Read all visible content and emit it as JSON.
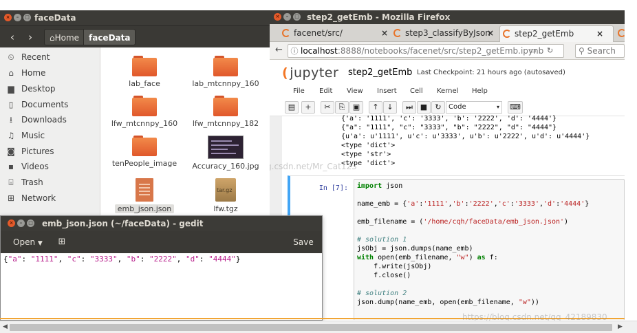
{
  "nautilus": {
    "title": "faceData",
    "nav": {
      "back": "‹",
      "forward": "›"
    },
    "breadcrumb": {
      "home": "Home",
      "current": "faceData"
    },
    "sidebar": [
      {
        "icon": "clock-icon",
        "glyph": "⏲",
        "label": "Recent"
      },
      {
        "icon": "home-icon",
        "glyph": "⌂",
        "label": "Home"
      },
      {
        "icon": "desktop-icon",
        "glyph": "▆",
        "label": "Desktop"
      },
      {
        "icon": "documents-icon",
        "glyph": "▯",
        "label": "Documents"
      },
      {
        "icon": "downloads-icon",
        "glyph": "⭳",
        "label": "Downloads"
      },
      {
        "icon": "music-icon",
        "glyph": "♫",
        "label": "Music"
      },
      {
        "icon": "pictures-icon",
        "glyph": "◙",
        "label": "Pictures"
      },
      {
        "icon": "videos-icon",
        "glyph": "▪",
        "label": "Videos"
      },
      {
        "icon": "trash-icon",
        "glyph": "⌻",
        "label": "Trash"
      },
      {
        "icon": "network-icon",
        "glyph": "⊞",
        "label": "Network"
      }
    ],
    "files": [
      {
        "name": "lab_face",
        "kind": "folder"
      },
      {
        "name": "lab_mtcnnpy_160",
        "kind": "folder"
      },
      {
        "name": "lfw_mtcnnpy_160",
        "kind": "folder"
      },
      {
        "name": "lfw_mtcnnpy_182",
        "kind": "folder"
      },
      {
        "name": "tenPeople_image",
        "kind": "folder"
      },
      {
        "name": "Accuracy_160.jpg",
        "kind": "image"
      },
      {
        "name": "emb_json.json",
        "kind": "document",
        "selected": true
      },
      {
        "name": "lfw.tgz",
        "kind": "archive",
        "badge": "tar.gz"
      }
    ]
  },
  "firefox": {
    "title": "step2_getEmb - Mozilla Firefox",
    "tabs": [
      {
        "label": "facenet/src/",
        "close": "×"
      },
      {
        "label": "step3_classifyByJson",
        "close": "×"
      },
      {
        "label": "step2_getEmb",
        "close": "×",
        "active": true
      }
    ],
    "url": {
      "host": "localhost",
      "rest": ":8888/notebooks/facenet/src/step2_getEmb.ipynb"
    },
    "search_placeholder": "Search"
  },
  "jupyter": {
    "logo": "jupyter",
    "notebook_name": "step2_getEmb",
    "checkpoint": "Last Checkpoint: 21 hours ago (autosaved)",
    "menu": [
      "File",
      "Edit",
      "View",
      "Insert",
      "Cell",
      "Kernel",
      "Help"
    ],
    "cell_type": "Code",
    "output_lines": [
      "{'a': '1111', 'c': '3333', 'b': '2222', 'd': '4444'}",
      "{\"a\": \"1111\", \"c\": \"3333\", \"b\": \"2222\", \"d\": \"4444\"}",
      "{u'a': u'1111', u'c': u'3333', u'b': u'2222', u'd': u'4444'}",
      "<type 'dict'>",
      "<type 'str'>",
      "<type 'dict'>"
    ],
    "prompt": "In [7]:",
    "code": {
      "l1_kw": "import",
      "l1_rest": " json",
      "l2_a": "name_emb = {",
      "l2_s1": "'a'",
      "l2_c1": ":",
      "l2_s2": "'1111'",
      "l2_c2": ",",
      "l2_s3": "'b'",
      "l2_c3": ":",
      "l2_s4": "'2222'",
      "l2_c4": ",",
      "l2_s5": "'c'",
      "l2_c5": ":",
      "l2_s6": "'3333'",
      "l2_c6": ",",
      "l2_s7": "'d'",
      "l2_c7": ":",
      "l2_s8": "'4444'",
      "l2_end": "}",
      "l3_a": "emb_filename = (",
      "l3_s": "'/home/cqh/faceData/emb_json.json'",
      "l3_end": ")",
      "l4_cm": "# solution 1",
      "l5": "jsObj = json.dumps(name_emb)",
      "l6_kw": "with",
      "l6_a": " open(emb_filename, ",
      "l6_s": "\"w\"",
      "l6_b": ") ",
      "l6_kw2": "as",
      "l6_c": " f:",
      "l7": "    f.write(jsObj)",
      "l8": "    f.close()",
      "l9_cm": "# solution 2",
      "l10_a": "json.dump(name_emb, open(emb_filename, ",
      "l10_s": "\"w\"",
      "l10_end": "))"
    }
  },
  "gedit": {
    "title": "emb_json.json (~/faceData) - gedit",
    "open_label": "Open",
    "save_label": "Save",
    "content": {
      "o": "{",
      "k1": "\"a\"",
      "c1": ": ",
      "v1": "\"1111\"",
      "s1": ", ",
      "k2": "\"c\"",
      "c2": ": ",
      "v2": "\"3333\"",
      "s2": ", ",
      "k3": "\"b\"",
      "c3": ": ",
      "v3": "\"2222\"",
      "s3": ", ",
      "k4": "\"d\"",
      "c4": ": ",
      "v4": "\"4444\"",
      "e": "}"
    }
  },
  "watermarks": {
    "middle": "http://blog.csdn.net/Mr_Cat123",
    "bottom": "https://blog.csdn.net/qq_42189830"
  },
  "colors": {
    "accent_orange": "#e8742a",
    "ubuntu_titlebar": "#3c3b37",
    "jupyter_blue": "#42a5f5"
  }
}
